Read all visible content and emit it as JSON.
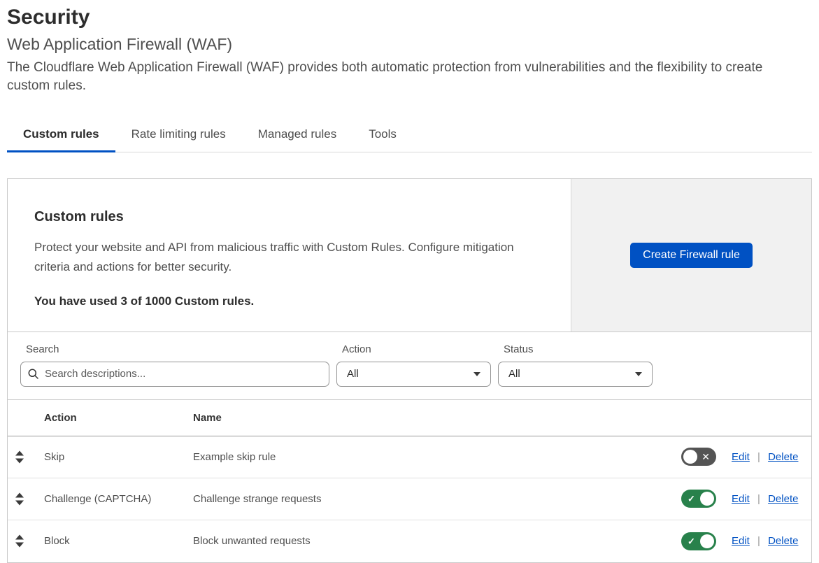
{
  "page": {
    "title": "Security",
    "subtitle": "Web Application Firewall (WAF)",
    "description": "The Cloudflare Web Application Firewall (WAF) provides both automatic protection from vulnerabilities and the flexibility to create custom rules."
  },
  "tabs": [
    {
      "label": "Custom rules",
      "active": true
    },
    {
      "label": "Rate limiting rules",
      "active": false
    },
    {
      "label": "Managed rules",
      "active": false
    },
    {
      "label": "Tools",
      "active": false
    }
  ],
  "panel": {
    "title": "Custom rules",
    "description": "Protect your website and API from malicious traffic with Custom Rules. Configure mitigation criteria and actions for better security.",
    "usage": "You have used 3 of 1000 Custom rules.",
    "create_button_label": "Create Firewall rule"
  },
  "filters": {
    "search_label": "Search",
    "search_placeholder": "Search descriptions...",
    "search_icon": "magnifier-icon",
    "action_label": "Action",
    "action_value": "All",
    "status_label": "Status",
    "status_value": "All"
  },
  "table": {
    "columns": [
      "Action",
      "Name"
    ],
    "rows": [
      {
        "action": "Skip",
        "name": "Example skip rule",
        "enabled": false
      },
      {
        "action": "Challenge (CAPTCHA)",
        "name": "Challenge strange requests",
        "enabled": true
      },
      {
        "action": "Block",
        "name": "Block unwanted requests",
        "enabled": true
      }
    ],
    "edit_label": "Edit",
    "delete_label": "Delete",
    "link_separator": "|",
    "toggle_on_icon": "check",
    "toggle_off_icon": "cross",
    "drag_handle_icon": "drag-sort-icon"
  },
  "colors": {
    "accent_blue": "#0051c3",
    "toggle_on_green": "#28814b",
    "toggle_off_gray": "#545454"
  }
}
